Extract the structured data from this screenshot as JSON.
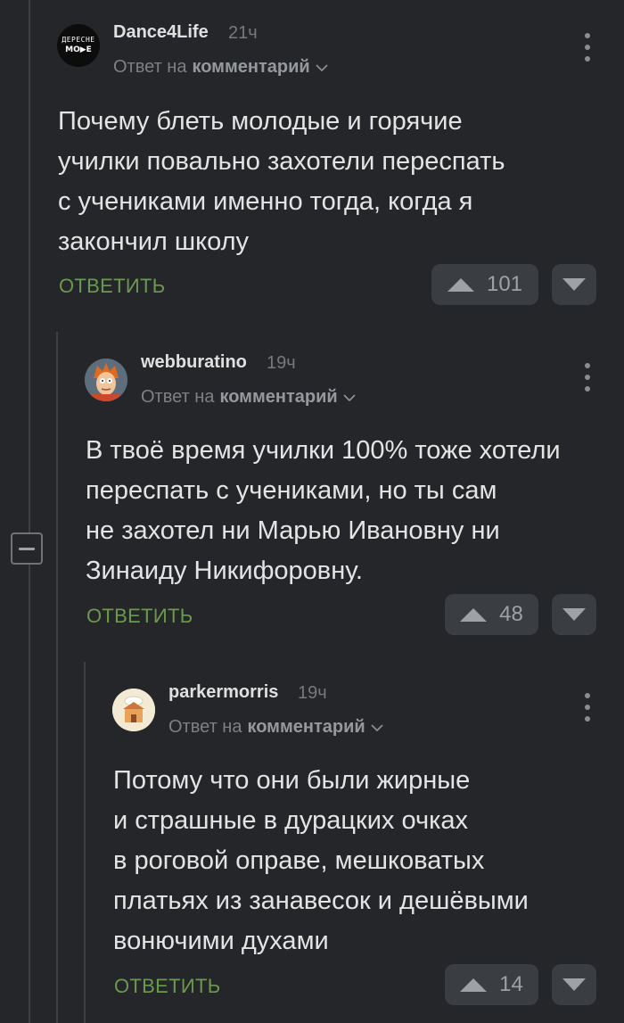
{
  "comments": [
    {
      "username": "Dance4Life",
      "time": "21ч",
      "reply_prefix": "Ответ на",
      "reply_target": "комментарий",
      "avatar_text": [
        "ДЕРЕСНЕ",
        "MO▶E"
      ],
      "text_lines": [
        "Почему блеть молодые и горячие",
        "училки повально захотели переспать",
        "с учениками именно тогда, когда я",
        "закончил школу"
      ],
      "reply_label": "ОТВЕТИТЬ",
      "rating": "101"
    },
    {
      "username": "webburatino",
      "time": "19ч",
      "reply_prefix": "Ответ на",
      "reply_target": "комментарий",
      "text_lines": [
        "В твоё время училки 100% тоже хотели",
        "переспать с учениками, но ты сам",
        "не захотел ни Марью Ивановну ни",
        "Зинаиду Никифоровну."
      ],
      "reply_label": "ОТВЕТИТЬ",
      "rating": "48"
    },
    {
      "username": "parkermorris",
      "time": "19ч",
      "reply_prefix": "Ответ на",
      "reply_target": "комментарий",
      "text_lines": [
        "Потому что они были жирные",
        "и страшные в дурацких очках",
        "в роговой оправе, мешковатых",
        "платьях из занавесок и дешёвыми",
        "вонючими духами"
      ],
      "reply_label": "ОТВЕТИТЬ",
      "rating": "14"
    }
  ]
}
